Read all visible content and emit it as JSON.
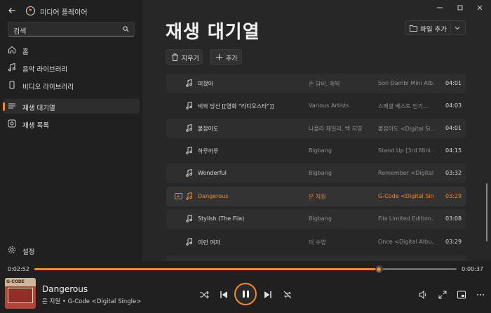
{
  "titlebar": {
    "app_title": "미디어 플레이어"
  },
  "search": {
    "placeholder": "검색"
  },
  "sidebar": {
    "items": [
      {
        "label": "홈"
      },
      {
        "label": "음악 라이브러리"
      },
      {
        "label": "비디오 라이브러리"
      },
      {
        "label": "재생 대기열"
      },
      {
        "label": "재생 목록"
      }
    ],
    "settings_label": "설정"
  },
  "main": {
    "title": "재생 대기열",
    "add_file_label": "파일 추가",
    "clear_label": "지우기",
    "add_label": "추가"
  },
  "queue": [
    {
      "title": "미쳤어",
      "artist": "손 담비, 에픽",
      "album": "Son Dambi Mini Alb...",
      "duration": "04:01"
    },
    {
      "title": "비와 당신 [[영화 \"라디오스타\"]]",
      "artist": "Various Artists",
      "album": "스페셜 베스트 인기...",
      "duration": "04:03"
    },
    {
      "title": "붙잡아도",
      "artist": "나플라 제일리, 백 지영",
      "album": "붙잡아도 <Digital Si...",
      "duration": "04:01"
    },
    {
      "title": "하루하루",
      "artist": "Bigbang",
      "album": "Stand Up [3rd Mini...",
      "duration": "04:15"
    },
    {
      "title": "Wonderful",
      "artist": "Bigbang",
      "album": "Remember <Digital...",
      "duration": "03:32"
    },
    {
      "title": "Dangerous",
      "artist": "은 지원",
      "album": "G-Code <Digital Sin...",
      "duration": "03:29"
    },
    {
      "title": "Stylish (The Fila)",
      "artist": "Bigbang",
      "album": "Fila Limited Edition...",
      "duration": "03:08"
    },
    {
      "title": "이런 여자",
      "artist": "이 수영",
      "album": "Once <Digital Albu...",
      "duration": "03:29"
    }
  ],
  "player": {
    "current_time": "0:02:52",
    "total_time": "0:00:37",
    "progress": 0.815,
    "title": "Dangerous",
    "subtitle": "은 지원 • G-Code <Digital Single>",
    "album_art_text": "G-CODE"
  },
  "colors": {
    "accent": "#f08a2c",
    "background": "#202020",
    "panel": "#272727"
  }
}
